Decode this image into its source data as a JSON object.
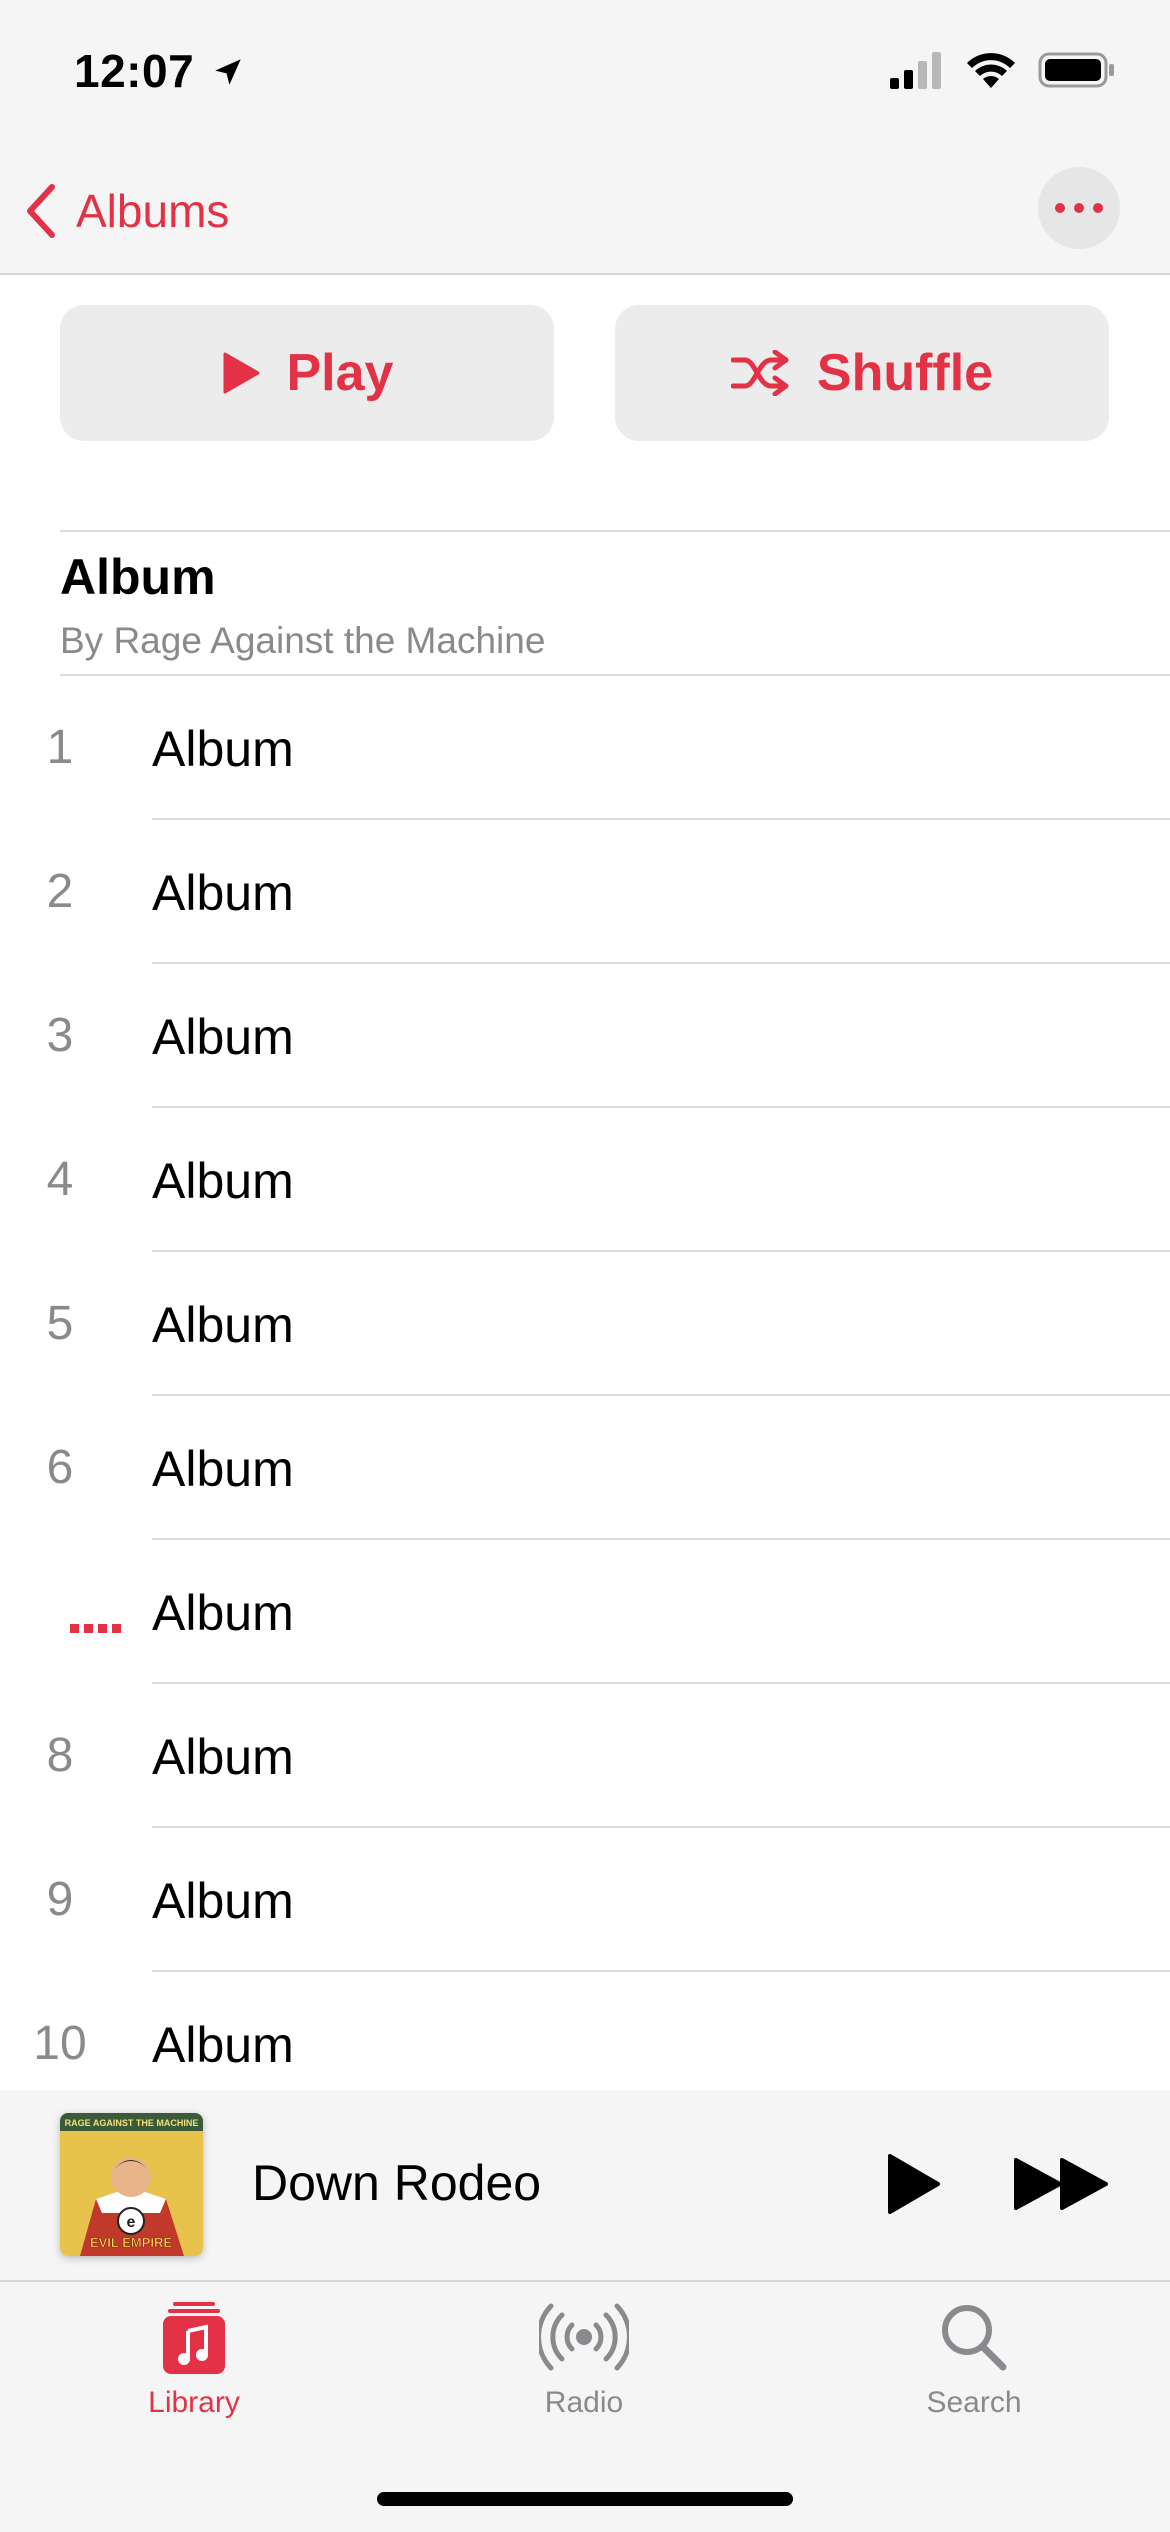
{
  "status_bar": {
    "time": "12:07",
    "icons": [
      "location-arrow-icon",
      "cellular-signal-icon",
      "wifi-icon",
      "battery-icon"
    ]
  },
  "nav": {
    "back_label": "Albums",
    "more_icon": "ellipsis-icon"
  },
  "actions": {
    "play_label": "Play",
    "shuffle_label": "Shuffle"
  },
  "album": {
    "title": "Album",
    "artist_line": "By Rage Against the Machine"
  },
  "tracks": [
    {
      "number": "1",
      "title": "Album"
    },
    {
      "number": "2",
      "title": "Album"
    },
    {
      "number": "3",
      "title": "Album"
    },
    {
      "number": "4",
      "title": "Album"
    },
    {
      "number": "5",
      "title": "Album"
    },
    {
      "number": "6",
      "title": "Album"
    },
    {
      "number": "",
      "title": "Album",
      "now_playing": true
    },
    {
      "number": "8",
      "title": "Album"
    },
    {
      "number": "9",
      "title": "Album"
    },
    {
      "number": "10",
      "title": "Album"
    }
  ],
  "mini_player": {
    "track_title": "Down Rodeo",
    "artwork_text_top": "RAGE AGAINST THE MACHINE",
    "artwork_text_bottom": "EVIL EMPIRE"
  },
  "tabs": [
    {
      "label": "Library",
      "icon": "library-icon",
      "active": true
    },
    {
      "label": "Radio",
      "icon": "radio-icon",
      "active": false
    },
    {
      "label": "Search",
      "icon": "search-icon",
      "active": false
    }
  ],
  "colors": {
    "accent": "#e33245",
    "secondary_text": "#8a8a8e",
    "separator": "#dcdcdc",
    "bar_background": "#f5f5f5"
  }
}
